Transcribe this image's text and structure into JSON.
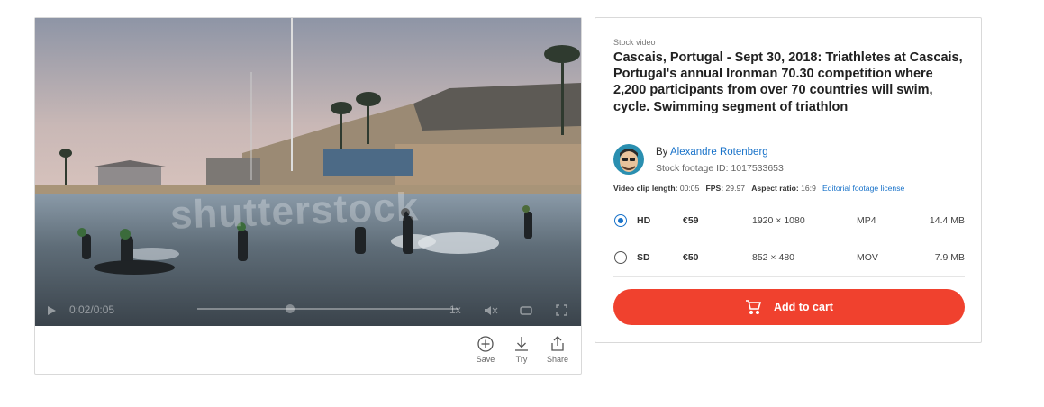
{
  "video": {
    "watermark": "shutterstock",
    "timecode": "0:02/0:05",
    "speed": "1x",
    "actions": [
      {
        "label": "Save",
        "icon": "plus-circle-icon"
      },
      {
        "label": "Try",
        "icon": "download-icon"
      },
      {
        "label": "Share",
        "icon": "share-icon"
      }
    ]
  },
  "panel": {
    "eyebrow": "Stock video",
    "title": "Cascais, Portugal - Sept 30, 2018: Triathletes at Cascais, Portugal's annual Ironman 70.30 competition where 2,200 participants from over 70 countries will swim, cycle. Swimming segment of triathlon",
    "by_label": "By",
    "author": "Alexandre Rotenberg",
    "footage_id": "Stock footage ID: 1017533653",
    "meta": {
      "length_label": "Video clip length:",
      "length": "00:05",
      "fps_label": "FPS:",
      "fps": "29.97",
      "aspect_label": "Aspect ratio:",
      "aspect": "16:9",
      "license": "Editorial footage license"
    },
    "options": [
      {
        "name": "HD",
        "price": "€59",
        "resolution": "1920 × 1080",
        "format": "MP4",
        "size": "14.4 MB",
        "selected": true
      },
      {
        "name": "SD",
        "price": "€50",
        "resolution": "852 × 480",
        "format": "MOV",
        "size": "7.9 MB",
        "selected": false
      }
    ],
    "cart_label": "Add to cart",
    "accent": "#f0412e",
    "link_color": "#1872c9"
  }
}
